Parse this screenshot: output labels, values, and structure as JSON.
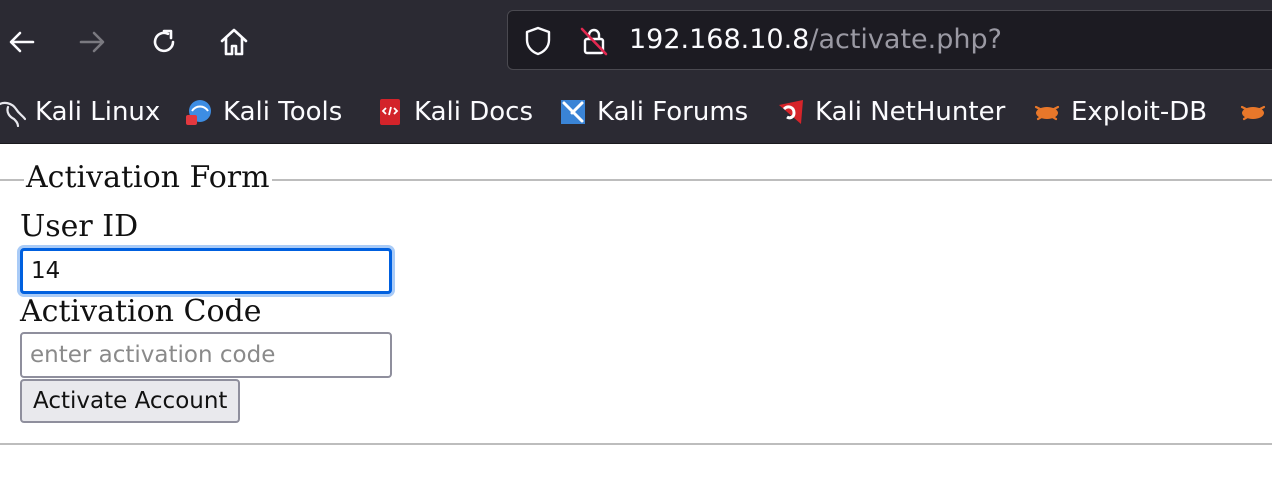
{
  "browser": {
    "url_host": "192.168.10.8",
    "url_path": "/activate.php?",
    "bookmarks": [
      {
        "label": "Kali Linux",
        "icon": "kali-dragon-icon"
      },
      {
        "label": "Kali Tools",
        "icon": "kali-tools-icon"
      },
      {
        "label": "Kali Docs",
        "icon": "kali-docs-icon"
      },
      {
        "label": "Kali Forums",
        "icon": "kali-forums-icon"
      },
      {
        "label": "Kali NetHunter",
        "icon": "kali-nethunter-icon"
      },
      {
        "label": "Exploit-DB",
        "icon": "exploit-db-icon"
      }
    ],
    "colors": {
      "toolbar": "#2b2a33",
      "urlbar": "#1c1b22",
      "focus": "#0060df"
    }
  },
  "form": {
    "legend": "Activation Form",
    "user_id_label": "User ID",
    "user_id_value": "14",
    "code_label": "Activation Code",
    "code_placeholder": "enter activation code",
    "submit_label": "Activate Account"
  }
}
